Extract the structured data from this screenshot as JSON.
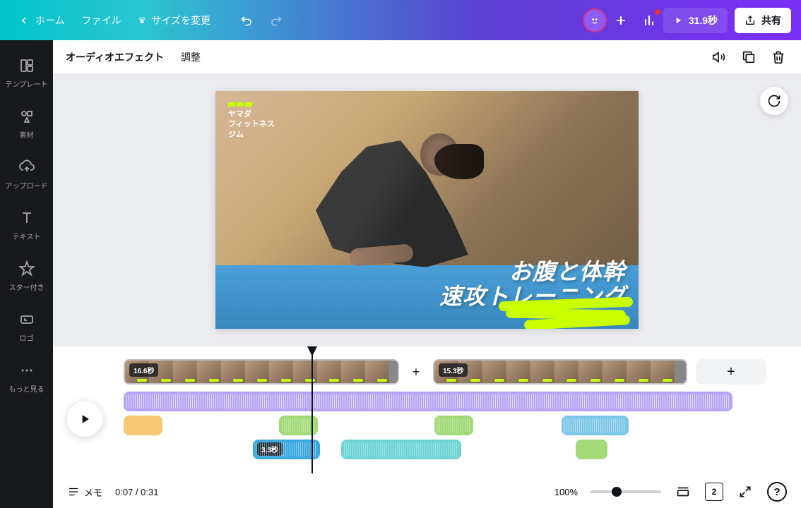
{
  "header": {
    "home": "ホーム",
    "file": "ファイル",
    "resize": "サイズを変更",
    "duration": "31.9秒",
    "share": "共有"
  },
  "sidebar": {
    "templates": "テンプレート",
    "elements": "素材",
    "uploads": "アップロード",
    "text": "テキスト",
    "starred": "スター付き",
    "logo": "ロゴ",
    "more": "もっと見る"
  },
  "toolbar": {
    "audioEffects": "オーディオエフェクト",
    "adjust": "調整"
  },
  "canvas": {
    "brand_line1": "ヤマダ",
    "brand_line2": "フィットネス",
    "brand_line3": "ジム",
    "title_line1": "お腹と体幹",
    "title_line2": "速攻トレーニング"
  },
  "timeline": {
    "clip1": "16.6秒",
    "clip2": "15.3秒",
    "clip_blue": "3.3秒"
  },
  "bottombar": {
    "memo": "メモ",
    "time": "0:07 / 0:31",
    "zoom": "100%",
    "page": "2"
  }
}
